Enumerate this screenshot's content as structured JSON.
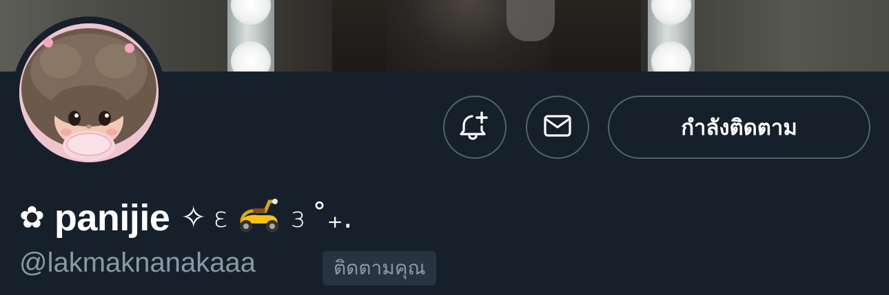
{
  "profile": {
    "display_name": "panijie",
    "name_prefix_symbol": "✿",
    "name_decorations": {
      "sparkle": "✧",
      "left_wing": "ɛ",
      "emoji_name": "yellow-scooter",
      "right_wing": "ɜ",
      "tail": "˚₊."
    },
    "handle": "@lakmaknanakaaa",
    "follows_you_label": "ติดตามคุณ"
  },
  "actions": {
    "notification_icon": "bell-plus-icon",
    "message_icon": "envelope-icon",
    "following_label": "กำลังติดตาม"
  },
  "theme": {
    "background": "#15202b",
    "border": "#536471",
    "secondary_text": "#8b98a5",
    "badge_bg": "#273340",
    "primary_text": "#ffffff"
  }
}
